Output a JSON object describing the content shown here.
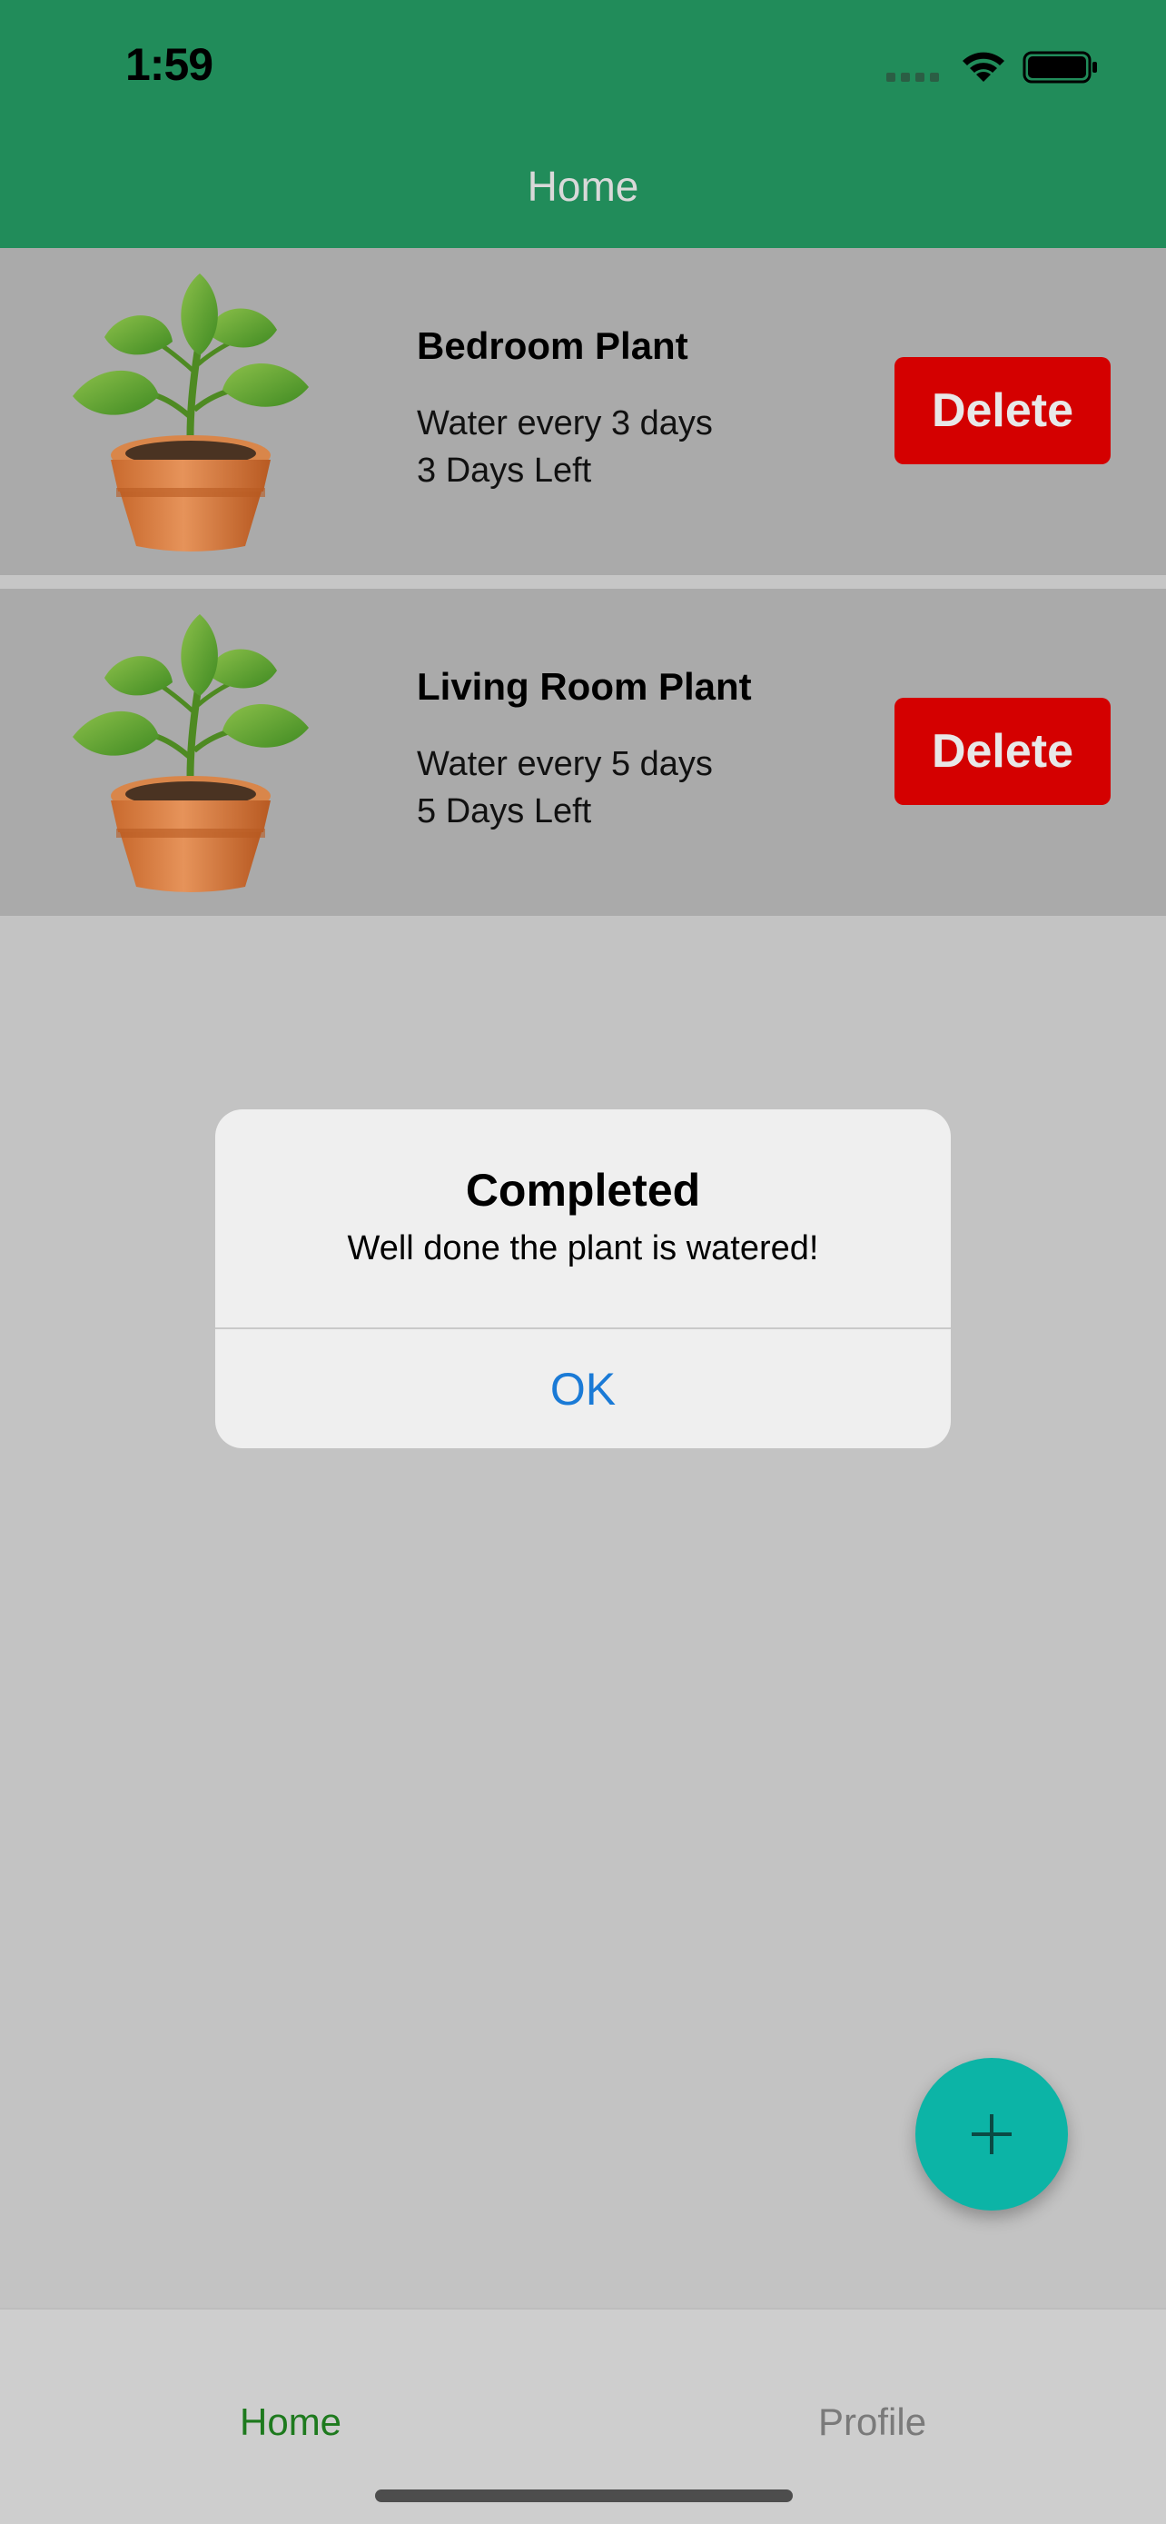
{
  "status_bar": {
    "time": "1:59"
  },
  "header": {
    "title": "Home"
  },
  "plants": [
    {
      "name": "Bedroom Plant",
      "frequency": "Water every 3 days",
      "remaining": "3 Days Left",
      "delete_label": "Delete",
      "icon": "potted-plant-icon"
    },
    {
      "name": "Living Room Plant",
      "frequency": "Water every 5 days",
      "remaining": "5 Days Left",
      "delete_label": "Delete",
      "icon": "potted-plant-icon"
    }
  ],
  "alert": {
    "title": "Completed",
    "message": "Well done the plant is watered!",
    "ok_label": "OK"
  },
  "fab": {
    "icon": "plus-icon"
  },
  "tabbar": {
    "home_label": "Home",
    "profile_label": "Profile"
  },
  "colors": {
    "header": "#218c5a",
    "delete": "#d40000",
    "fab": "#0cb4a6",
    "tab_active": "#1e7a1e",
    "alert_button": "#1a7ad6"
  }
}
